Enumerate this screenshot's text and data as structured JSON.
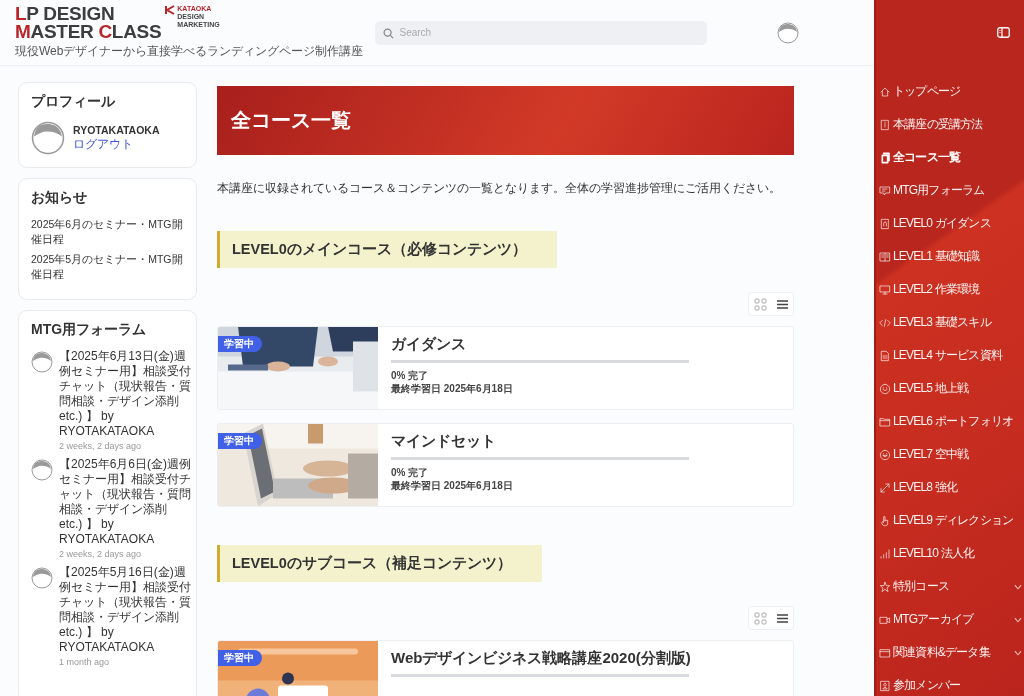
{
  "header": {
    "logo": {
      "lines": [
        [
          {
            "text": "L",
            "accent": true
          },
          {
            "text": "P DESIGN",
            "accent": false
          }
        ],
        [
          {
            "text": "M",
            "accent": true
          },
          {
            "text": "ASTER ",
            "accent": false
          },
          {
            "text": "C",
            "accent": true
          },
          {
            "text": "LASS",
            "accent": false
          }
        ]
      ],
      "brand": [
        "KATAOKA",
        "DESIGN",
        "MARKETING"
      ],
      "tagline": "現役Webデザイナーから直接学べるランディングページ制作講座"
    },
    "search": {
      "placeholder": "Search"
    }
  },
  "profile": {
    "title": "プロフィール",
    "name": "RYOTAKATAOKA",
    "logout": "ログアウト"
  },
  "notices": {
    "title": "お知らせ",
    "items": [
      "2025年6月のセミナー・MTG開催日程",
      "2025年5月のセミナー・MTG開催日程"
    ]
  },
  "forum": {
    "title": "MTG用フォーラム",
    "items": [
      {
        "topic": "【2025年6月13日(金)週例セミナー用】相談受付チャット（現状報告・質問相談・デザイン添削 etc.) 】",
        "author": "by RYOTAKATAOKA",
        "time": "2 weeks, 2 days ago"
      },
      {
        "topic": "【2025年6月6日(金)週例セミナー用】相談受付チャット（現状報告・質問相談・デザイン添削 etc.) 】",
        "author": "by RYOTAKATAOKA",
        "time": "2 weeks, 2 days ago"
      },
      {
        "topic": "【2025年5月16日(金)週例セミナー用】相談受付チャット（現状報告・質問相談・デザイン添削 etc.) 】",
        "author": "by RYOTAKATAOKA",
        "time": "1 month ago"
      }
    ]
  },
  "page": {
    "title": "全コース一覧",
    "intro": "本講座に収録されているコース＆コンテンツの一覧となります。全体の学習進捗管理にご活用ください。"
  },
  "sections": [
    {
      "heading": "LEVEL0のメインコース（必修コンテンツ）",
      "view": [
        {
          "selected": false
        },
        {
          "selected": true
        }
      ],
      "courses": [
        {
          "badge": "学習中",
          "title": "ガイダンス",
          "progress": {
            "level": 0
          },
          "complete": "0% 完了",
          "last": "最終学習日 2025年6月18日"
        },
        {
          "badge": "学習中",
          "title": "マインドセット",
          "progress": {
            "level": 0
          },
          "complete": "0% 完了",
          "last": "最終学習日 2025年6月18日"
        }
      ]
    },
    {
      "heading": "LEVEL0のサブコース（補足コンテンツ）",
      "view": [
        {
          "selected": false
        },
        {
          "selected": true
        }
      ],
      "courses": [
        {
          "badge": "学習中",
          "title": "Webデザインビジネス戦略講座2020(分割版)",
          "progress": {
            "level": 0
          }
        }
      ]
    }
  ],
  "nav": {
    "items": [
      {
        "label": "トップページ",
        "selected": false
      },
      {
        "label": "本講座の受講方法",
        "selected": false
      },
      {
        "label": "全コース一覧",
        "selected": true
      },
      {
        "label": "MTG用フォーラム",
        "selected": false
      },
      {
        "label": "LEVEL0 ガイダンス",
        "selected": false
      },
      {
        "label": "LEVEL1 基礎知識",
        "selected": false
      },
      {
        "label": "LEVEL2 作業環境",
        "selected": false
      },
      {
        "label": "LEVEL3 基礎スキル",
        "selected": false
      },
      {
        "label": "LEVEL4 サービス資料",
        "selected": false
      },
      {
        "label": "LEVEL5 地上戦",
        "selected": false
      },
      {
        "label": "LEVEL6 ポートフォリオ",
        "selected": false
      },
      {
        "label": "LEVEL7 空中戦",
        "selected": false
      },
      {
        "label": "LEVEL8 強化",
        "selected": false
      },
      {
        "label": "LEVEL9 ディレクション",
        "selected": false
      },
      {
        "label": "LEVEL10 法人化",
        "selected": false
      },
      {
        "label": "特別コース",
        "selected": false,
        "expanded": false
      },
      {
        "label": "MTGアーカイブ",
        "selected": false,
        "expanded": false
      },
      {
        "label": "関連資料&データ集",
        "selected": false,
        "expanded": false
      },
      {
        "label": "参加メンバー",
        "selected": false
      }
    ]
  }
}
